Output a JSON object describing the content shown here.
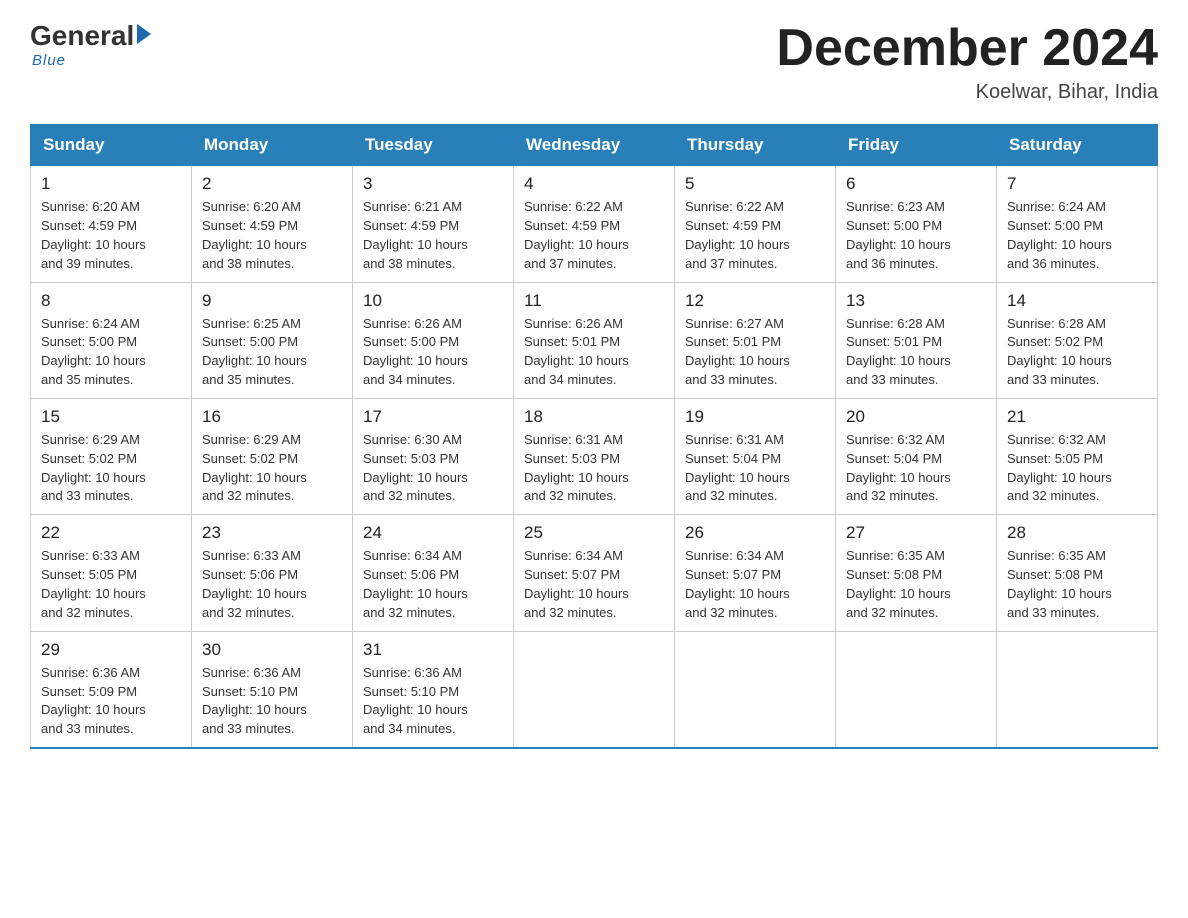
{
  "header": {
    "logo": {
      "general": "General",
      "blue": "Blue",
      "tagline": "Blue"
    },
    "title": "December 2024",
    "location": "Koelwar, Bihar, India"
  },
  "days_of_week": [
    "Sunday",
    "Monday",
    "Tuesday",
    "Wednesday",
    "Thursday",
    "Friday",
    "Saturday"
  ],
  "weeks": [
    [
      {
        "day": "1",
        "sunrise": "6:20 AM",
        "sunset": "4:59 PM",
        "daylight": "10 hours and 39 minutes."
      },
      {
        "day": "2",
        "sunrise": "6:20 AM",
        "sunset": "4:59 PM",
        "daylight": "10 hours and 38 minutes."
      },
      {
        "day": "3",
        "sunrise": "6:21 AM",
        "sunset": "4:59 PM",
        "daylight": "10 hours and 38 minutes."
      },
      {
        "day": "4",
        "sunrise": "6:22 AM",
        "sunset": "4:59 PM",
        "daylight": "10 hours and 37 minutes."
      },
      {
        "day": "5",
        "sunrise": "6:22 AM",
        "sunset": "4:59 PM",
        "daylight": "10 hours and 37 minutes."
      },
      {
        "day": "6",
        "sunrise": "6:23 AM",
        "sunset": "5:00 PM",
        "daylight": "10 hours and 36 minutes."
      },
      {
        "day": "7",
        "sunrise": "6:24 AM",
        "sunset": "5:00 PM",
        "daylight": "10 hours and 36 minutes."
      }
    ],
    [
      {
        "day": "8",
        "sunrise": "6:24 AM",
        "sunset": "5:00 PM",
        "daylight": "10 hours and 35 minutes."
      },
      {
        "day": "9",
        "sunrise": "6:25 AM",
        "sunset": "5:00 PM",
        "daylight": "10 hours and 35 minutes."
      },
      {
        "day": "10",
        "sunrise": "6:26 AM",
        "sunset": "5:00 PM",
        "daylight": "10 hours and 34 minutes."
      },
      {
        "day": "11",
        "sunrise": "6:26 AM",
        "sunset": "5:01 PM",
        "daylight": "10 hours and 34 minutes."
      },
      {
        "day": "12",
        "sunrise": "6:27 AM",
        "sunset": "5:01 PM",
        "daylight": "10 hours and 33 minutes."
      },
      {
        "day": "13",
        "sunrise": "6:28 AM",
        "sunset": "5:01 PM",
        "daylight": "10 hours and 33 minutes."
      },
      {
        "day": "14",
        "sunrise": "6:28 AM",
        "sunset": "5:02 PM",
        "daylight": "10 hours and 33 minutes."
      }
    ],
    [
      {
        "day": "15",
        "sunrise": "6:29 AM",
        "sunset": "5:02 PM",
        "daylight": "10 hours and 33 minutes."
      },
      {
        "day": "16",
        "sunrise": "6:29 AM",
        "sunset": "5:02 PM",
        "daylight": "10 hours and 32 minutes."
      },
      {
        "day": "17",
        "sunrise": "6:30 AM",
        "sunset": "5:03 PM",
        "daylight": "10 hours and 32 minutes."
      },
      {
        "day": "18",
        "sunrise": "6:31 AM",
        "sunset": "5:03 PM",
        "daylight": "10 hours and 32 minutes."
      },
      {
        "day": "19",
        "sunrise": "6:31 AM",
        "sunset": "5:04 PM",
        "daylight": "10 hours and 32 minutes."
      },
      {
        "day": "20",
        "sunrise": "6:32 AM",
        "sunset": "5:04 PM",
        "daylight": "10 hours and 32 minutes."
      },
      {
        "day": "21",
        "sunrise": "6:32 AM",
        "sunset": "5:05 PM",
        "daylight": "10 hours and 32 minutes."
      }
    ],
    [
      {
        "day": "22",
        "sunrise": "6:33 AM",
        "sunset": "5:05 PM",
        "daylight": "10 hours and 32 minutes."
      },
      {
        "day": "23",
        "sunrise": "6:33 AM",
        "sunset": "5:06 PM",
        "daylight": "10 hours and 32 minutes."
      },
      {
        "day": "24",
        "sunrise": "6:34 AM",
        "sunset": "5:06 PM",
        "daylight": "10 hours and 32 minutes."
      },
      {
        "day": "25",
        "sunrise": "6:34 AM",
        "sunset": "5:07 PM",
        "daylight": "10 hours and 32 minutes."
      },
      {
        "day": "26",
        "sunrise": "6:34 AM",
        "sunset": "5:07 PM",
        "daylight": "10 hours and 32 minutes."
      },
      {
        "day": "27",
        "sunrise": "6:35 AM",
        "sunset": "5:08 PM",
        "daylight": "10 hours and 32 minutes."
      },
      {
        "day": "28",
        "sunrise": "6:35 AM",
        "sunset": "5:08 PM",
        "daylight": "10 hours and 33 minutes."
      }
    ],
    [
      {
        "day": "29",
        "sunrise": "6:36 AM",
        "sunset": "5:09 PM",
        "daylight": "10 hours and 33 minutes."
      },
      {
        "day": "30",
        "sunrise": "6:36 AM",
        "sunset": "5:10 PM",
        "daylight": "10 hours and 33 minutes."
      },
      {
        "day": "31",
        "sunrise": "6:36 AM",
        "sunset": "5:10 PM",
        "daylight": "10 hours and 34 minutes."
      },
      null,
      null,
      null,
      null
    ]
  ],
  "labels": {
    "sunrise": "Sunrise: ",
    "sunset": "Sunset: ",
    "daylight": "Daylight: "
  }
}
